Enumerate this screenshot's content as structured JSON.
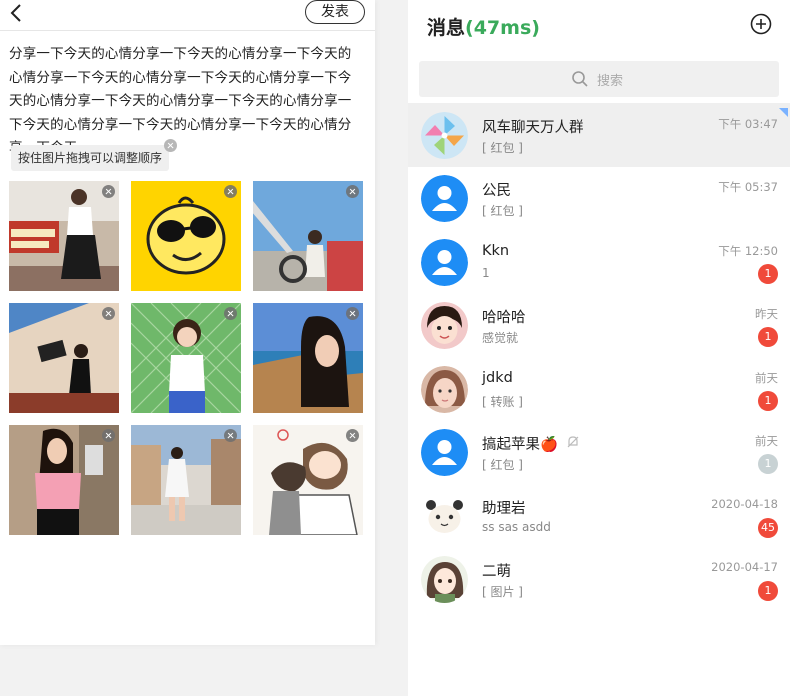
{
  "post": {
    "publish_label": "发表",
    "content": "分享一下今天的心情分享一下今天的心情分享一下今天的心情分享一下今天的心情分享一下今天的心情分享一下今天的心情分享一下今天的心情分享一下今天的心情分享一下今天的心情分享一下今天的心情分享一下今天的心情分享一下今天",
    "drag_tip": "按住图片拖拽可以调整顺序",
    "images": [
      {
        "icon": "photo-girl-sign-icon"
      },
      {
        "icon": "yellow-emoji-sunglasses-icon"
      },
      {
        "icon": "photo-girl-sky-icon"
      },
      {
        "icon": "photo-girl-wall-icon"
      },
      {
        "icon": "photo-girl-fence-icon"
      },
      {
        "icon": "photo-girl-sea-icon"
      },
      {
        "icon": "photo-girl-pink-icon"
      },
      {
        "icon": "photo-girl-street-icon"
      },
      {
        "icon": "cartoon-couple-icon"
      }
    ]
  },
  "messages": {
    "title": "消息",
    "latency": "(47ms)",
    "search_placeholder": "搜索",
    "conversations": [
      {
        "name": "风车聊天万人群",
        "preview": "[ 红包 ]",
        "time": "下午 03:47",
        "badge": "",
        "pinned": true,
        "avatar": "pinwheel-icon"
      },
      {
        "name": "公民",
        "preview": "[ 红包 ]",
        "time": "下午 05:37",
        "badge": "",
        "avatar": "default-user-icon"
      },
      {
        "name": "Kkn",
        "preview": "1",
        "time": "下午 12:50",
        "badge": "1",
        "avatar": "default-user-icon"
      },
      {
        "name": "哈哈哈",
        "preview": "感觉就",
        "time": "昨天",
        "badge": "1",
        "avatar": "child-photo-icon"
      },
      {
        "name": "jdkd",
        "preview": "[ 转账 ]",
        "time": "前天",
        "badge": "1",
        "avatar": "girl-photo-icon"
      },
      {
        "name": "搞起苹果🍎",
        "preview": "[ 红包 ]",
        "time": "前天",
        "badge": "1",
        "muted": true,
        "avatar": "default-user-icon"
      },
      {
        "name": "助理岩",
        "preview": "ss sas asdd",
        "time": "2020-04-18",
        "badge": "45",
        "avatar": "panda-icon"
      },
      {
        "name": "二萌",
        "preview": "[ 图片 ]",
        "time": "2020-04-17",
        "badge": "1",
        "avatar": "anime-girl-icon"
      }
    ]
  }
}
